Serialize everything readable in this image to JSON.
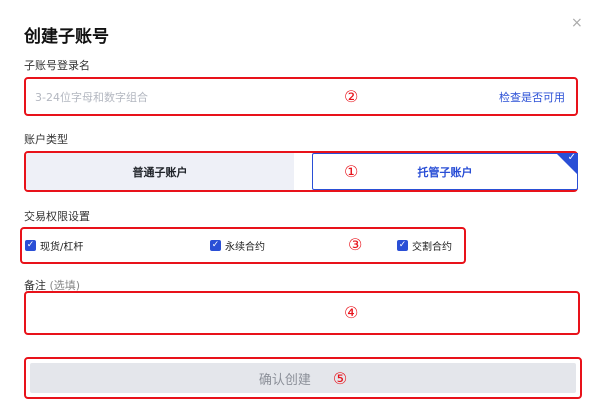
{
  "dialog": {
    "title": "创建子账号",
    "close_icon": "×"
  },
  "login_name": {
    "label": "子账号登录名",
    "placeholder": "3-24位字母和数字组合",
    "check_link": "检查是否可用",
    "marker": "②"
  },
  "account_type": {
    "label": "账户类型",
    "options": [
      "普通子账户",
      "托管子账户"
    ],
    "selected": "托管子账户",
    "marker": "①"
  },
  "permissions": {
    "label": "交易权限设置",
    "items": [
      {
        "label": "现货/杠杆",
        "checked": true
      },
      {
        "label": "永续合约",
        "checked": true
      },
      {
        "label": "交割合约",
        "checked": true
      }
    ],
    "marker": "③"
  },
  "note": {
    "label": "备注",
    "label_suffix": "(选填)",
    "marker": "④"
  },
  "confirm": {
    "label": "确认创建",
    "marker": "⑤"
  },
  "colors": {
    "accent": "#2a4fd6",
    "highlight": "#e8121a"
  }
}
